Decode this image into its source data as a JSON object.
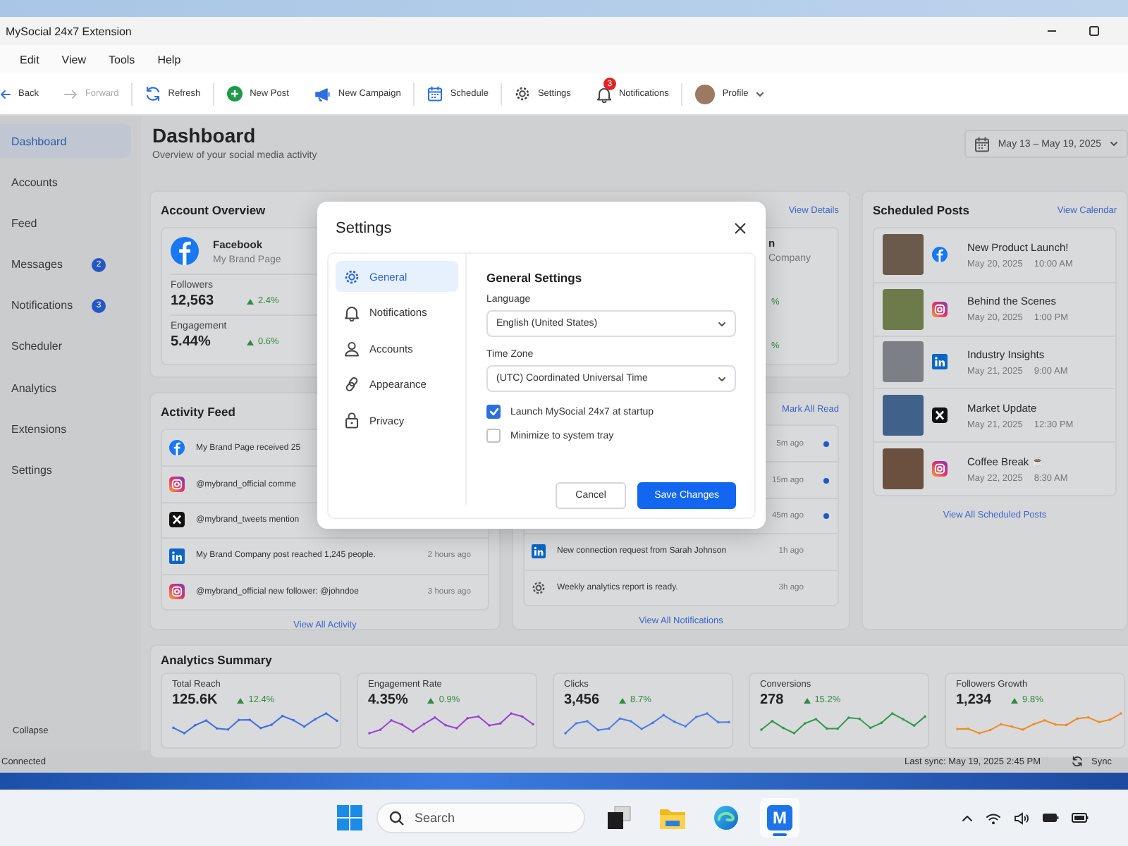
{
  "window": {
    "title": "MySocial 24x7 Extension"
  },
  "menu": [
    "Edit",
    "View",
    "Tools",
    "Help"
  ],
  "toolbar": [
    {
      "label": "Back",
      "kind": "back",
      "disabled": false
    },
    {
      "label": "Forward",
      "kind": "forward",
      "disabled": true
    },
    {
      "label": "Refresh",
      "kind": "refresh",
      "disabled": false
    },
    {
      "label": "New Post",
      "kind": "new-post",
      "disabled": false
    },
    {
      "label": "New Campaign",
      "kind": "campaign",
      "disabled": false
    },
    {
      "label": "Schedule",
      "kind": "schedule",
      "disabled": false
    },
    {
      "label": "Settings",
      "kind": "settings",
      "disabled": false
    },
    {
      "label": "Notifications",
      "kind": "notifications",
      "disabled": false,
      "badge": "3"
    },
    {
      "label": "Profile",
      "kind": "profile",
      "disabled": false
    }
  ],
  "sidebar": {
    "items": [
      {
        "label": "Dashboard",
        "selected": true
      },
      {
        "label": "Accounts",
        "selected": false
      },
      {
        "label": "Feed",
        "selected": false
      },
      {
        "label": "Messages",
        "selected": false,
        "badge": "2"
      },
      {
        "label": "Notifications",
        "selected": false,
        "badge": "3"
      },
      {
        "label": "Scheduler",
        "selected": false
      },
      {
        "label": "Analytics",
        "selected": false
      },
      {
        "label": "Extensions",
        "selected": false
      },
      {
        "label": "Settings",
        "selected": false
      }
    ],
    "collapse": "Collapse"
  },
  "header": {
    "title": "Dashboard",
    "subtitle": "Overview of your social media activity",
    "date_range": "May 13 – May 19, 2025"
  },
  "account_overview": {
    "title": "Account Overview",
    "link": "View Details",
    "account": {
      "kind": "facebook",
      "name": "Facebook",
      "page": "My Brand Page",
      "stats": [
        {
          "label": "Followers",
          "value": "12,563",
          "change": "2.4%"
        },
        {
          "label": "Engagement",
          "value": "5.44%",
          "change": "0.6%"
        }
      ]
    },
    "partial_account": {
      "name": "n",
      "page": "Company",
      "changes": [
        "%",
        "%"
      ]
    }
  },
  "activity_feed": {
    "title": "Activity Feed",
    "items": [
      {
        "kind": "facebook",
        "text": "My Brand Page received 25"
      },
      {
        "kind": "instagram",
        "text": "@mybrand_official comme"
      },
      {
        "kind": "x",
        "text": "@mybrand_tweets mention"
      },
      {
        "kind": "linkedin",
        "text": "My Brand Company post reached 1,245 people.",
        "time": "2 hours ago"
      },
      {
        "kind": "instagram",
        "text": "@mybrand_official new follower: @johndoe",
        "time": "3 hours ago"
      }
    ],
    "link": "View All Activity"
  },
  "notifications_panel": {
    "action": "Mark All Read",
    "items": [
      {
        "time": "5m ago",
        "unread": true
      },
      {
        "time": "15m ago",
        "unread": true
      },
      {
        "time": "45m ago",
        "unread": true
      },
      {
        "kind": "linkedin",
        "text": "New connection request from Sarah Johnson",
        "time": "1h ago",
        "unread": false
      },
      {
        "kind": "gear",
        "text": "Weekly analytics report is ready.",
        "time": "3h ago",
        "unread": false
      }
    ],
    "link": "View All Notifications"
  },
  "scheduled_posts": {
    "title": "Scheduled Posts",
    "link": "View Calendar",
    "posts": [
      {
        "title": "New Product Launch!",
        "kind": "facebook",
        "date": "May 20, 2025",
        "time": "10:00 AM"
      },
      {
        "title": "Behind the Scenes",
        "kind": "instagram",
        "date": "May 20, 2025",
        "time": "1:00 PM"
      },
      {
        "title": "Industry Insights",
        "kind": "linkedin",
        "date": "May 21, 2025",
        "time": "9:00 AM"
      },
      {
        "title": "Market Update",
        "kind": "x",
        "date": "May 21, 2025",
        "time": "12:30 PM"
      },
      {
        "title": "Coffee Break ☕",
        "kind": "instagram",
        "date": "May 22, 2025",
        "time": "8:30 AM"
      }
    ],
    "footer_link": "View All Scheduled Posts"
  },
  "analytics": {
    "title": "Analytics Summary",
    "metrics": [
      {
        "label": "Total Reach",
        "value": "125.6K",
        "change": "12.4%",
        "color": "#3d6fe0"
      },
      {
        "label": "Engagement Rate",
        "value": "4.35%",
        "change": "0.9%",
        "color": "#9b3fd6"
      },
      {
        "label": "Clicks",
        "value": "3,456",
        "change": "8.7%",
        "color": "#4a7ee6"
      },
      {
        "label": "Conversions",
        "value": "278",
        "change": "15.2%",
        "color": "#2f9a48"
      },
      {
        "label": "Followers Growth",
        "value": "1,234",
        "change": "9.8%",
        "color": "#ef8c1e"
      }
    ]
  },
  "status_bar": {
    "connection": "Connected",
    "last_sync": "Last sync: May 19, 2025 2:45 PM",
    "sync": "Sync"
  },
  "dialog": {
    "title": "Settings",
    "nav": [
      {
        "label": "General",
        "kind": "gear",
        "selected": true
      },
      {
        "label": "Notifications",
        "kind": "bell",
        "selected": false
      },
      {
        "label": "Accounts",
        "kind": "person",
        "selected": false
      },
      {
        "label": "Appearance",
        "kind": "link",
        "selected": false
      },
      {
        "label": "Privacy",
        "kind": "lock",
        "selected": false
      }
    ],
    "heading": "General Settings",
    "fields": [
      {
        "label": "Language",
        "value": "English (United States)"
      },
      {
        "label": "Time Zone",
        "value": "(UTC) Coordinated Universal Time"
      }
    ],
    "options": [
      {
        "label": "Launch MySocial 24x7 at startup",
        "checked": true
      },
      {
        "label": "Minimize to system tray",
        "checked": false
      }
    ],
    "buttons": [
      {
        "label": "Cancel",
        "kind": "secondary"
      },
      {
        "label": "Save Changes",
        "kind": "primary"
      }
    ]
  },
  "taskbar": {
    "search_placeholder": "Search",
    "apps": [
      {
        "kind": "task-view",
        "selected": false
      },
      {
        "kind": "folder",
        "selected": false
      },
      {
        "kind": "browser",
        "selected": false
      },
      {
        "kind": "app",
        "label": "M",
        "selected": true
      }
    ]
  }
}
